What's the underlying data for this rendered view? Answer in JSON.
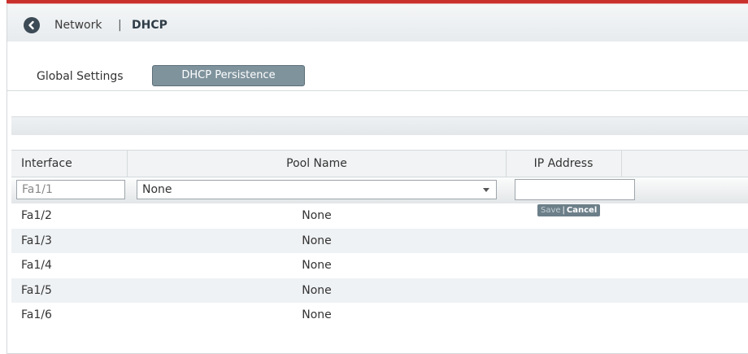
{
  "breadcrumb": {
    "parent": "Network",
    "separator": "|",
    "current": "DHCP"
  },
  "tabs": [
    {
      "label": "Global Settings",
      "active": false
    },
    {
      "label": "DHCP Persistence",
      "active": true
    }
  ],
  "table": {
    "columns": [
      "Interface",
      "Pool Name",
      "IP Address"
    ],
    "edit_row": {
      "interface": "Fa1/1",
      "pool_selected": "None",
      "ip_address": ""
    },
    "actions": {
      "save": "Save",
      "separator": "|",
      "cancel": "Cancel"
    },
    "rows": [
      {
        "interface": "Fa1/2",
        "pool": "None",
        "ip": ""
      },
      {
        "interface": "Fa1/3",
        "pool": "None",
        "ip": ""
      },
      {
        "interface": "Fa1/4",
        "pool": "None",
        "ip": ""
      },
      {
        "interface": "Fa1/5",
        "pool": "None",
        "ip": ""
      },
      {
        "interface": "Fa1/6",
        "pool": "None",
        "ip": ""
      }
    ]
  },
  "colors": {
    "accent_top": "#c9302c",
    "active_tab": "#7f939d",
    "back_button": "#3d4b57"
  }
}
